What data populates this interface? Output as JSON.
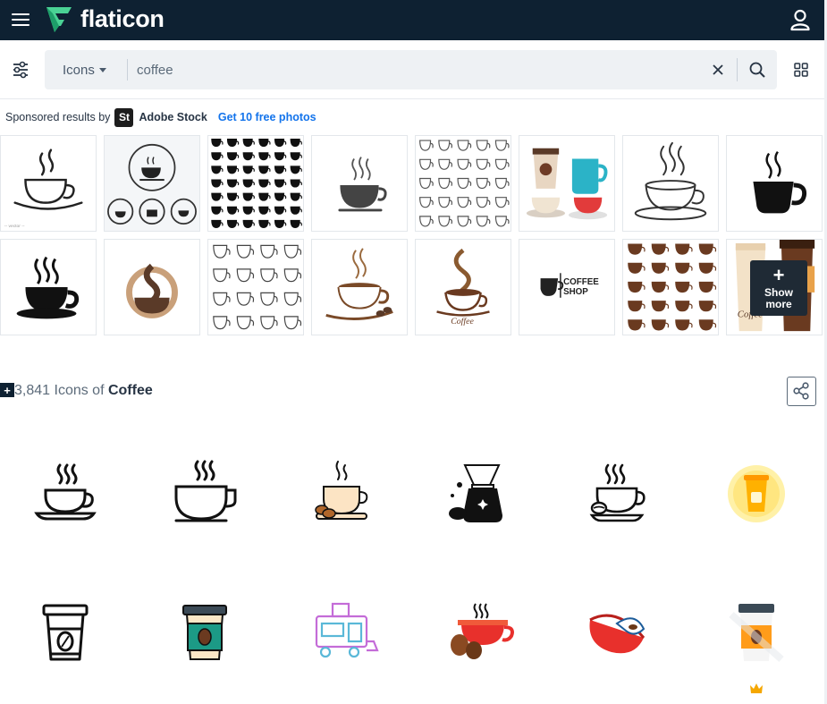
{
  "header": {
    "logo_text": "flaticon",
    "colors": {
      "bar": "#0e2132",
      "logo_green": "#4ad295"
    }
  },
  "search": {
    "type_label": "Icons",
    "query": "coffee"
  },
  "sponsored": {
    "label": "Sponsored results by",
    "provider_badge": "St",
    "provider": "Adobe Stock",
    "cta": "Get 10 free photos"
  },
  "stock_tiles": {
    "vector_caption": "-- vector --",
    "coffee_shop_line1": "COFFEE",
    "coffee_shop_line2": "SHOP",
    "script_label": "Coffee",
    "show_more_plus": "+",
    "show_more_label": "Show more"
  },
  "results": {
    "plus": "+",
    "count": "3,841",
    "middle": " Icons of ",
    "term": "Coffee"
  },
  "icons": [
    {
      "name": "coffee-cup-outline-icon",
      "premium": false
    },
    {
      "name": "coffee-mug-outline-icon",
      "premium": false
    },
    {
      "name": "coffee-cup-beans-icon",
      "premium": false
    },
    {
      "name": "coffee-dripper-icon",
      "premium": false
    },
    {
      "name": "coffee-cup-bean-outline-icon",
      "premium": false
    },
    {
      "name": "takeaway-cup-circle-icon",
      "premium": false
    },
    {
      "name": "paper-cup-outline-icon",
      "premium": false
    },
    {
      "name": "paper-cup-green-icon",
      "premium": false
    },
    {
      "name": "coffee-truck-icon",
      "premium": false
    },
    {
      "name": "red-cup-beans-icon",
      "premium": false
    },
    {
      "name": "spilling-cup-icon",
      "premium": false
    },
    {
      "name": "orange-paper-cup-icon",
      "premium": true
    }
  ]
}
